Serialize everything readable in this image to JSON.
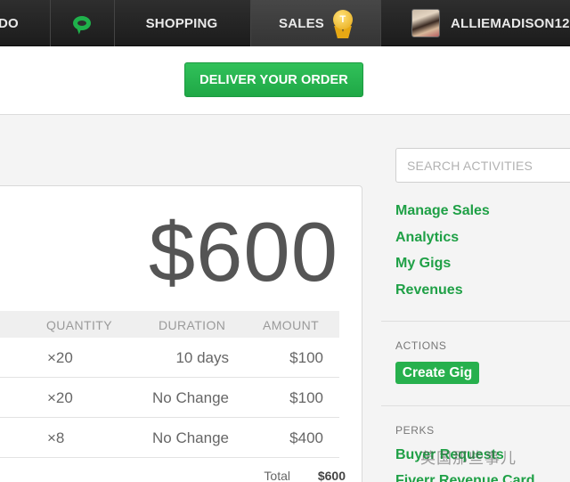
{
  "nav": {
    "first_label": "DO",
    "shopping_label": "SHOPPING",
    "sales_label": "SALES",
    "badge_letter": "T",
    "username": "ALLIEMADISON12"
  },
  "deliver_button": "DELIVER YOUR ORDER",
  "order": {
    "price": "$600",
    "columns": [
      "QUANTITY",
      "DURATION",
      "AMOUNT"
    ],
    "rows": [
      {
        "quantity": "×20",
        "duration": "10 days",
        "amount": "$100"
      },
      {
        "quantity": "×20",
        "duration": "No Change",
        "amount": "$100"
      },
      {
        "quantity": "×8",
        "duration": "No Change",
        "amount": "$400"
      }
    ],
    "total_label": "Total",
    "total_value": "$600"
  },
  "sidebar": {
    "search_placeholder": "SEARCH ACTIVITIES",
    "links": [
      "Manage Sales",
      "Analytics",
      "My Gigs",
      "Revenues"
    ],
    "actions_heading": "ACTIONS",
    "create_gig": "Create Gig",
    "perks_heading": "PERKS",
    "perks_links": [
      "Buyer Requests",
      "Fiverr Revenue Card"
    ]
  },
  "watermark": "英国那些事儿",
  "colors": {
    "accent": "#1fa046",
    "nav_bg": "#242424",
    "button": "#27b04d"
  }
}
